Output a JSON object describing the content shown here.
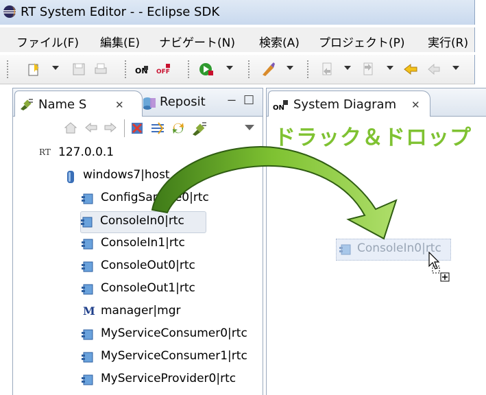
{
  "window": {
    "title": "RT System Editor -  - Eclipse SDK"
  },
  "menu": [
    {
      "label": "ファイル(F)"
    },
    {
      "label": "編集(E)"
    },
    {
      "label": "ナビゲート(N)"
    },
    {
      "label": "検索(A)"
    },
    {
      "label": "プロジェクト(P)"
    },
    {
      "label": "実行(R)"
    }
  ],
  "toolbar_icons": [
    "new-wizard-icon",
    "save-icon",
    "print-icon",
    "online-icon",
    "offline-icon",
    "run-icon",
    "debug-icon",
    "back-nav-icon",
    "forward-nav-icon",
    "history-icon",
    "prev-icon",
    "next-icon"
  ],
  "left_view": {
    "tab_active": "Name S",
    "tab_inactive": "Reposit",
    "minimize": "ー",
    "maximize": "□"
  },
  "right_view": {
    "tab_label": "System Diagram"
  },
  "tree": {
    "root": "127.0.0.1",
    "root_prefix": "RT",
    "host": "windows7|host_cxt",
    "items": [
      {
        "label": "ConfigSample0|rtc",
        "kind": "rtc"
      },
      {
        "label": "ConsoleIn0|rtc",
        "kind": "rtc",
        "selected": true
      },
      {
        "label": "ConsoleIn1|rtc",
        "kind": "rtc"
      },
      {
        "label": "ConsoleOut0|rtc",
        "kind": "rtc"
      },
      {
        "label": "ConsoleOut1|rtc",
        "kind": "rtc"
      },
      {
        "label": "manager|mgr",
        "kind": "manager",
        "icon_letter": "M"
      },
      {
        "label": "MyServiceConsumer0|rtc",
        "kind": "rtc"
      },
      {
        "label": "MyServiceConsumer1|rtc",
        "kind": "rtc"
      },
      {
        "label": "MyServiceProvider0|rtc",
        "kind": "rtc"
      }
    ]
  },
  "annotation": {
    "text": "ドラック＆ドロップ",
    "color": "#7fc232"
  },
  "drag_ghost": {
    "label": "ConsoleIn0|rtc"
  },
  "colors": {
    "accent_blue": "#3a6fb7",
    "arrow_green": "#7fc232",
    "arrow_dark": "#3e7a18"
  }
}
